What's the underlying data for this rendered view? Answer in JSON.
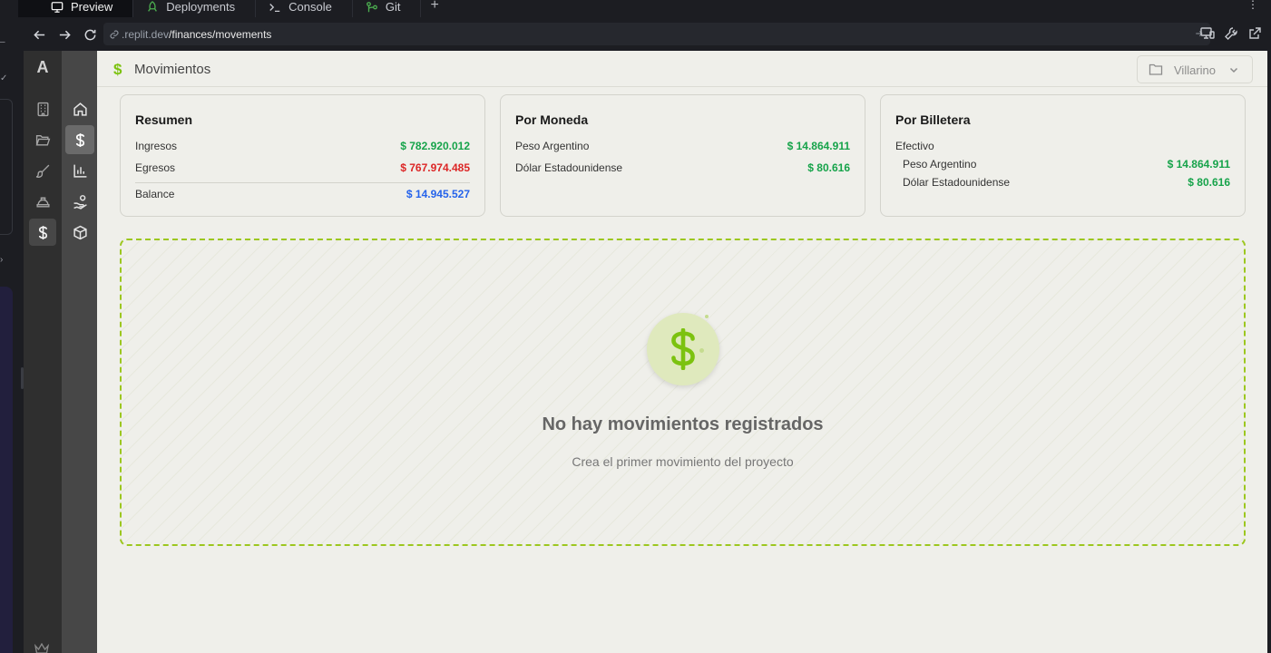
{
  "tabs": [
    {
      "label": "Preview",
      "icon": "monitor-icon"
    },
    {
      "label": "Deployments",
      "icon": "rocket-icon"
    },
    {
      "label": "Console",
      "icon": "terminal-icon"
    },
    {
      "label": "Git",
      "icon": "git-icon"
    }
  ],
  "address": {
    "domain": ".replit.dev",
    "path": "/finances/movements"
  },
  "brand": "A",
  "header": {
    "title": "Movimientos",
    "project": "Villarino"
  },
  "cards": {
    "summary": {
      "title": "Resumen",
      "ingresos_label": "Ingresos",
      "ingresos_value": "$ 782.920.012",
      "egresos_label": "Egresos",
      "egresos_value": "$ 767.974.485",
      "balance_label": "Balance",
      "balance_value": "$ 14.945.527"
    },
    "currency": {
      "title": "Por Moneda",
      "rows": [
        {
          "label": "Peso Argentino",
          "value": "$ 14.864.911"
        },
        {
          "label": "Dólar Estadounidense",
          "value": "$ 80.616"
        }
      ]
    },
    "wallet": {
      "title": "Por Billetera",
      "group": "Efectivo",
      "rows": [
        {
          "label": "Peso Argentino",
          "value": "$ 14.864.911"
        },
        {
          "label": "Dólar Estadounidense",
          "value": "$ 80.616"
        }
      ]
    }
  },
  "empty": {
    "title": "No hay movimientos registrados",
    "subtitle": "Crea el primer movimiento del proyecto"
  },
  "colors": {
    "accent": "#7cc20f",
    "income": "#16a34a",
    "expense": "#dc2626",
    "balance": "#2563eb"
  }
}
